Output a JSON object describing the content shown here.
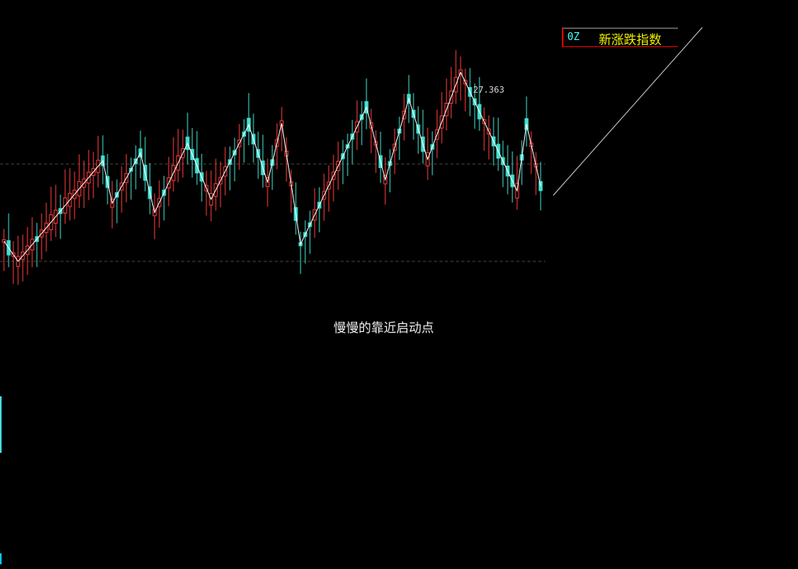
{
  "indicator": {
    "code": "0Z",
    "name": "新涨跌指数"
  },
  "annotation": "慢慢的靠近启动点",
  "chart_data": {
    "type": "candlestick",
    "title": "新涨跌指数",
    "peak_label": "27.363",
    "candle_count": 115,
    "price_range": [
      21.9,
      27.5
    ],
    "reference_lines": [
      24.79,
      22.06
    ],
    "zigzag": [
      {
        "i": 0,
        "price": 22.63
      },
      {
        "i": 3,
        "price": 22.06
      },
      {
        "i": 21,
        "price": 24.88
      },
      {
        "i": 23,
        "price": 23.69
      },
      {
        "i": 29,
        "price": 25.1
      },
      {
        "i": 32,
        "price": 23.43
      },
      {
        "i": 39,
        "price": 25.37
      },
      {
        "i": 44,
        "price": 23.8
      },
      {
        "i": 52,
        "price": 25.89
      },
      {
        "i": 56,
        "price": 24.28
      },
      {
        "i": 59,
        "price": 25.93
      },
      {
        "i": 63,
        "price": 22.54
      },
      {
        "i": 77,
        "price": 26.38
      },
      {
        "i": 81,
        "price": 24.35
      },
      {
        "i": 86,
        "price": 26.62
      },
      {
        "i": 90,
        "price": 24.92
      },
      {
        "i": 97,
        "price": 27.363
      },
      {
        "i": 109,
        "price": 24.04
      },
      {
        "i": 111,
        "price": 25.91
      },
      {
        "i": 114,
        "price": 24.17
      }
    ],
    "colors": {
      "up": "#ff3b3b",
      "down": "#40e0d0",
      "zigzag": "#ffffff"
    }
  }
}
